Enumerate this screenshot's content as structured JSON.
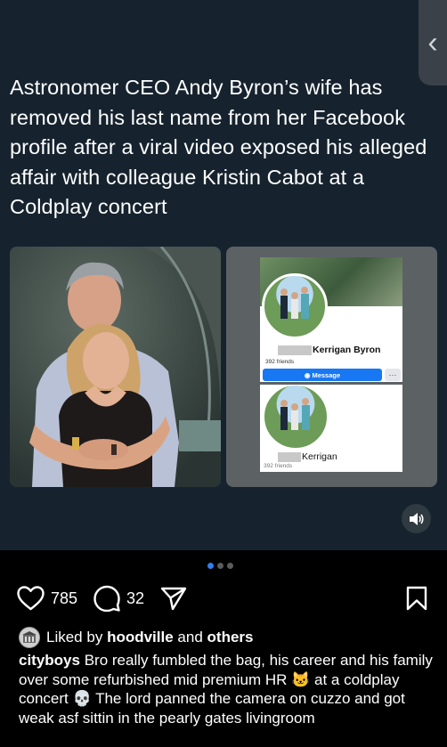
{
  "post": {
    "headline": "Astronomer CEO Andy Byron’s wife has removed his last name from her Facebook profile after a viral video exposed his alleged affair with colleague Kristin Cabot at a Coldplay concert",
    "profile_top": {
      "name": "Kerrigan Byron",
      "friends": "392 friends",
      "button": "Message",
      "more": "···"
    },
    "profile_bottom": {
      "name": "Kerrigan",
      "friends": "392 friends"
    },
    "back_icon": "chevron-left-icon",
    "sound_icon": "speaker-icon",
    "carousel": {
      "count": 3,
      "active_index": 0
    }
  },
  "actions": {
    "likes": "785",
    "comments": "32"
  },
  "liked_by": {
    "prefix": "Liked by",
    "user": "hoodville",
    "joiner": "and",
    "others": "others"
  },
  "caption": {
    "user": "cityboys",
    "part1": " Bro really fumbled the bag, his career and his family over some refurbished mid premium HR ",
    "emoji1": "🐱",
    "part2": " at a coldplay concert ",
    "emoji2": "💀",
    "part3": " The lord panned the camera on cuzzo and got weak asf sittin in the pearly gates livingroom"
  },
  "colors": {
    "post_bg": "#16232e",
    "app_bg": "#000000",
    "accent": "#2f7ff0"
  }
}
